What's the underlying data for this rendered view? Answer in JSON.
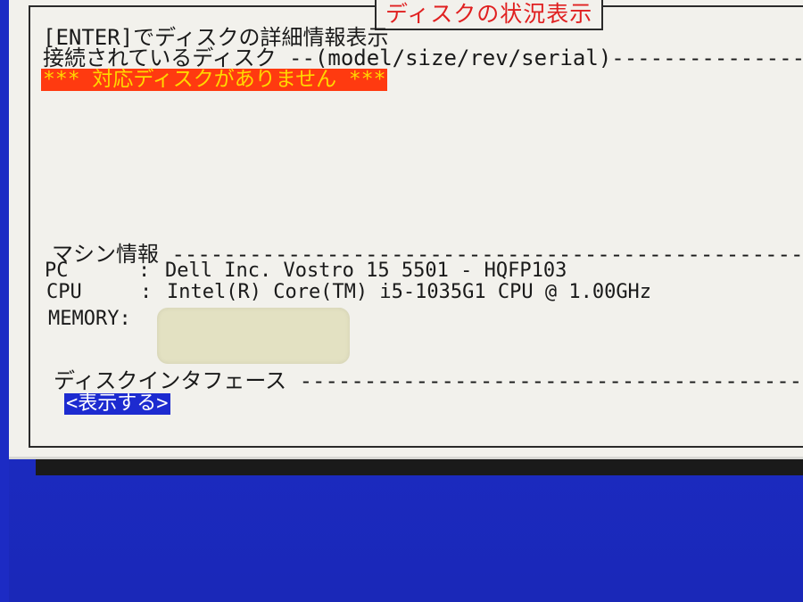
{
  "dialog": {
    "title": "ディスクの状況表示",
    "enter_hint": "[ENTER]でディスクの詳細情報表示",
    "disk_header": "接続されているディスク --(model/size/rev/serial)------------------",
    "no_disk_message": "*** 対応ディスクがありません ***"
  },
  "machine": {
    "header": "マシン情報 ------------------------------------------------------------",
    "pc_label": "PC",
    "pc_value": "Dell Inc. Vostro 15 5501 - HQFP103",
    "cpu_label": "CPU",
    "cpu_value": "Intel(R) Core(TM) i5-1035G1 CPU @ 1.00GHz",
    "memory_label": "MEMORY:",
    "colon": ":"
  },
  "interface": {
    "header": "ディスクインタフェース ------------------------------------------------",
    "show_button": "<表示する>"
  },
  "colors": {
    "background_blue": "#1f2fc8",
    "dialog_bg": "#f2f1ec",
    "title_red": "#e02020",
    "alert_bg": "#ff3a10",
    "alert_text": "#ffd800",
    "button_bg": "#1d2bd0"
  }
}
